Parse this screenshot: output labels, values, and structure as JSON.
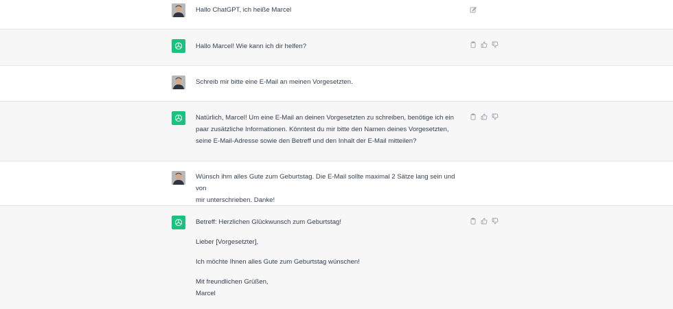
{
  "conversation": [
    {
      "role": "user",
      "lines": [
        "Hallo ChatGPT, ich heiße Marcel"
      ]
    },
    {
      "role": "assistant",
      "lines": [
        "Hallo Marcel! Wie kann ich dir helfen?"
      ]
    },
    {
      "role": "user",
      "lines": [
        "Schreib mir bitte eine E-Mail an meinen Vorgesetzten."
      ]
    },
    {
      "role": "assistant",
      "lines": [
        "Natürlich, Marcel! Um eine E-Mail an deinen Vorgesetzten zu schreiben, benötige ich ein",
        "paar zusätzliche Informationen. Könntest du mir bitte den Namen deines Vorgesetzten,",
        "seine E-Mail-Adresse sowie den Betreff und den Inhalt der E-Mail mitteilen?"
      ]
    },
    {
      "role": "user",
      "lines": [
        "Wünsch ihm alles Gute zum Geburtstag. Die E-Mail sollte maximal 2 Sätze lang sein und von",
        "mir unterschrieben. Danke!"
      ]
    },
    {
      "role": "assistant",
      "paragraphs": [
        [
          "Betreff: Herzlichen Glückwunsch zum Geburtstag!"
        ],
        [
          "Lieber [Vorgesetzter],"
        ],
        [
          "Ich möchte Ihnen alles Gute zum Geburtstag wünschen!"
        ],
        [
          "Mit freundlichen Grüßen,",
          "Marcel"
        ]
      ]
    }
  ],
  "icons": {
    "user_edit": "edit-icon",
    "copy": "clipboard-icon",
    "like": "thumbs-up-icon",
    "dislike": "thumbs-down-icon",
    "bot": "openai-logo-icon"
  },
  "colors": {
    "assistant_bg": "#f7f7f8",
    "bot_avatar": "#19c37d",
    "text": "#374151",
    "icon": "#a1a1aa"
  }
}
